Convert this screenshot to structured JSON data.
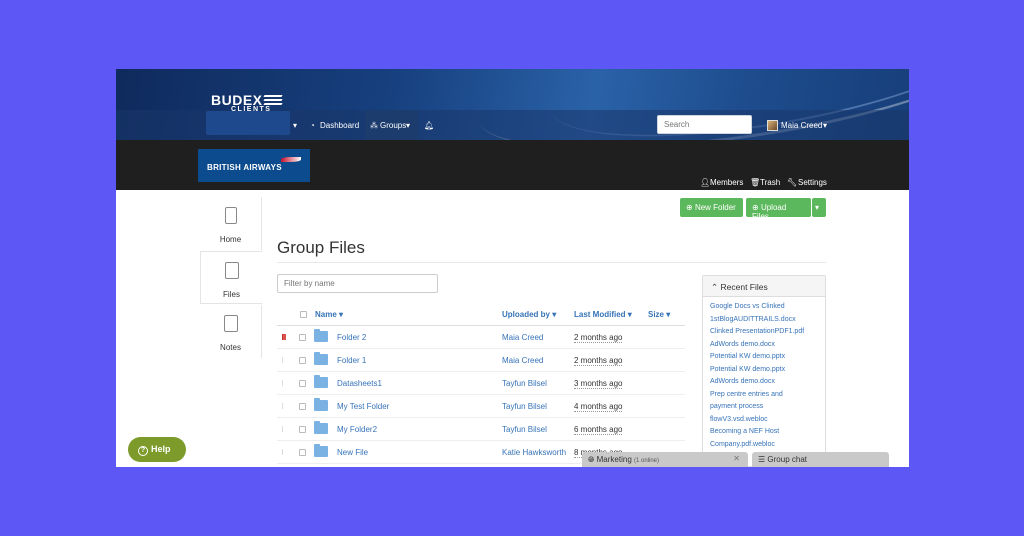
{
  "header": {
    "brand": "BUDEX",
    "brand_sub": "CLIENTS",
    "nav": {
      "dashboard": "Dashboard",
      "groups": "Groups"
    },
    "search_placeholder": "Search",
    "user_name": "Maia Creed"
  },
  "group": {
    "logo_text": "BRITISH AIRWAYS",
    "members": "Members",
    "trash": "Trash",
    "settings": "Settings"
  },
  "sidebar": {
    "items": [
      {
        "label": "Home",
        "icon": "phone-icon"
      },
      {
        "label": "Files",
        "icon": "files-icon"
      },
      {
        "label": "Notes",
        "icon": "notes-icon"
      }
    ]
  },
  "actions": {
    "new_folder": "New Folder",
    "upload_files": "Upload Files"
  },
  "main": {
    "title": "Group Files",
    "filter_placeholder": "Filter by name",
    "columns": {
      "name": "Name",
      "uploaded_by": "Uploaded by",
      "last_modified": "Last Modified",
      "size": "Size"
    },
    "rows": [
      {
        "name": "Folder 2",
        "uploaded_by": "Maia Creed",
        "modified": "2 months ago",
        "flagged": true
      },
      {
        "name": "Folder 1",
        "uploaded_by": "Maia Creed",
        "modified": "2 months ago",
        "flagged": false
      },
      {
        "name": "Datasheets1",
        "uploaded_by": "Tayfun Bilsel",
        "modified": "3 months ago",
        "flagged": false
      },
      {
        "name": "My Test Folder",
        "uploaded_by": "Tayfun Bilsel",
        "modified": "4 months ago",
        "flagged": false
      },
      {
        "name": "My Folder2",
        "uploaded_by": "Tayfun Bilsel",
        "modified": "6 months ago",
        "flagged": false
      },
      {
        "name": "New File",
        "uploaded_by": "Katie Hawksworth",
        "modified": "8 months ago",
        "flagged": false
      }
    ]
  },
  "recent_files": {
    "title": "Recent Files",
    "items": [
      "Google Docs vs Clinked",
      "1stBlogAUDITTRAILS.docx",
      "Clinked PresentationPDF1.pdf",
      "AdWords demo.docx",
      "Potential KW demo.pptx",
      "Potential KW demo.pptx",
      "AdWords demo.docx",
      "Prep centre entries and",
      "payment process",
      "flowV3.vsd.webloc",
      "Becoming a NEF Host",
      "Company.pdf.webloc"
    ]
  },
  "help": {
    "label": "Help"
  },
  "chat": {
    "marketing": "Marketing",
    "marketing_status": "(1 online)",
    "group_chat": "Group chat"
  },
  "colors": {
    "accent": "#3673b8",
    "button_green": "#5cb85c",
    "help_green": "#7d9b2a",
    "background": "#5c57f5"
  }
}
